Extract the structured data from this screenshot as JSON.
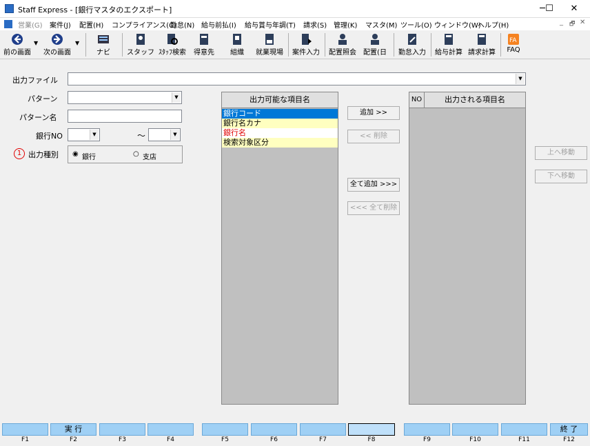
{
  "window": {
    "title": "Staff Express - [銀行マスタのエクスポート]",
    "minimize": "─",
    "maximize": "☐",
    "close": "✕"
  },
  "menu": [
    "営業(G)",
    "案件(J)",
    "配置(H)",
    "コンプライアンス(C)",
    "勤怠(N)",
    "給与前払(I)",
    "給与賞与年調(T)",
    "請求(S)",
    "管理(K)",
    "マスタ(M)",
    "ツール(O)",
    "ウィンドウ(W)",
    "ヘルプ(H)"
  ],
  "mdi": {
    "minimize": "_",
    "restore": "🗗",
    "close": "✕"
  },
  "toolbar": {
    "prev": "前の画面",
    "next": "次の画面",
    "navi": "ナビ",
    "staff": "スタッフ",
    "staff_search": "ｽﾀｯﾌ検索",
    "client": "得意先",
    "org": "組織",
    "site": "就業現場",
    "case_input": "案件入力",
    "assign_ref": "配置照会",
    "assign_day": "配置(日",
    "attend_input": "勤怠入力",
    "pay_calc": "給与計算",
    "bill_calc": "請求計算",
    "faq": "FAQ"
  },
  "form": {
    "output_file_label": "出力ファイル",
    "output_file_value": "",
    "pattern_label": "パターン",
    "pattern_value": "",
    "pattern_name_label": "パターン名",
    "pattern_name_value": "",
    "bank_no_label": "銀行NO",
    "bank_no_from": "",
    "tilde": "～",
    "bank_no_to": "",
    "marker": "1",
    "output_type_label": "出力種別",
    "radio_bank": "銀行",
    "radio_branch": "支店"
  },
  "available": {
    "header": "出力可能な項目名",
    "items": [
      "銀行コード",
      "銀行名カナ",
      "銀行名",
      "検索対象区分"
    ]
  },
  "buttons": {
    "add": "追加 >>",
    "remove": "<< 削除",
    "add_all": "全て追加 >>>",
    "remove_all": "<<< 全て削除",
    "move_up": "上へ移動",
    "move_down": "下へ移動"
  },
  "output": {
    "no_header": "NO",
    "header": "出力される項目名"
  },
  "fkeys": [
    "",
    "実 行",
    "",
    "",
    "",
    "",
    "",
    "",
    "",
    "",
    "",
    "終 了"
  ],
  "flabels": [
    "F1",
    "F2",
    "F3",
    "F4",
    "F5",
    "F6",
    "F7",
    "F8",
    "F9",
    "F10",
    "F11",
    "F12"
  ],
  "colors": {
    "selected_row": "#0078d7",
    "yellow_row": "#ffffc0",
    "red_text": "#e00000",
    "fkey": "#9fd0f5"
  }
}
